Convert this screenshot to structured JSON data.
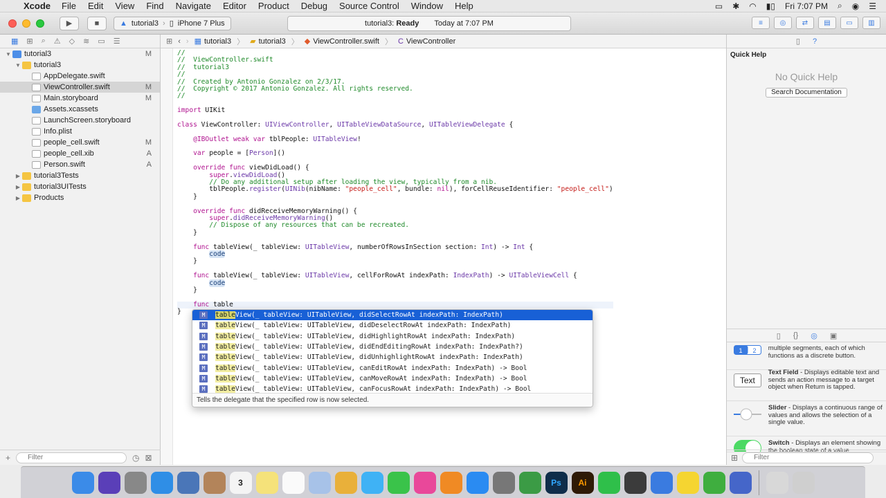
{
  "menubar": {
    "app": "Xcode",
    "menus": [
      "File",
      "Edit",
      "View",
      "Find",
      "Navigate",
      "Editor",
      "Product",
      "Debug",
      "Source Control",
      "Window",
      "Help"
    ],
    "clock": "Fri 7:07 PM"
  },
  "toolbar": {
    "scheme_target": "tutorial3",
    "scheme_device": "iPhone 7 Plus",
    "status_project": "tutorial3:",
    "status_state": "Ready",
    "status_time": "Today at 7:07 PM"
  },
  "navigator": {
    "items": [
      {
        "label": "tutorial3",
        "status": "M",
        "icon": "project-icon",
        "indent": 0,
        "tri": "▼"
      },
      {
        "label": "tutorial3",
        "status": "",
        "icon": "folder-icon",
        "indent": 1,
        "tri": "▼"
      },
      {
        "label": "AppDelegate.swift",
        "status": "",
        "icon": "swift-file-icon",
        "indent": 2,
        "tri": ""
      },
      {
        "label": "ViewController.swift",
        "status": "M",
        "icon": "swift-file-icon",
        "indent": 2,
        "tri": "",
        "selected": true
      },
      {
        "label": "Main.storyboard",
        "status": "M",
        "icon": "storyboard-icon",
        "indent": 2,
        "tri": ""
      },
      {
        "label": "Assets.xcassets",
        "status": "",
        "icon": "assets-icon",
        "indent": 2,
        "tri": ""
      },
      {
        "label": "LaunchScreen.storyboard",
        "status": "",
        "icon": "storyboard-icon",
        "indent": 2,
        "tri": ""
      },
      {
        "label": "Info.plist",
        "status": "",
        "icon": "plist-icon",
        "indent": 2,
        "tri": ""
      },
      {
        "label": "people_cell.swift",
        "status": "M",
        "icon": "swift-file-icon",
        "indent": 2,
        "tri": ""
      },
      {
        "label": "people_cell.xib",
        "status": "A",
        "icon": "xib-icon",
        "indent": 2,
        "tri": ""
      },
      {
        "label": "Person.swift",
        "status": "A",
        "icon": "swift-file-icon",
        "indent": 2,
        "tri": ""
      },
      {
        "label": "tutorial3Tests",
        "status": "",
        "icon": "folder-icon",
        "indent": 1,
        "tri": "▶"
      },
      {
        "label": "tutorial3UITests",
        "status": "",
        "icon": "folder-icon",
        "indent": 1,
        "tri": "▶"
      },
      {
        "label": "Products",
        "status": "",
        "icon": "folder-icon",
        "indent": 1,
        "tri": "▶"
      }
    ],
    "filter_placeholder": "Filter"
  },
  "jumpbar": {
    "crumbs": [
      "tutorial3",
      "tutorial3",
      "ViewController.swift",
      "ViewController"
    ]
  },
  "code_lines": [
    [
      {
        "t": "//",
        "c": "com"
      }
    ],
    [
      {
        "t": "//  ViewController.swift",
        "c": "com"
      }
    ],
    [
      {
        "t": "//  tutorial3",
        "c": "com"
      }
    ],
    [
      {
        "t": "//",
        "c": "com"
      }
    ],
    [
      {
        "t": "//  Created by Antonio Gonzalez on 2/3/17.",
        "c": "com"
      }
    ],
    [
      {
        "t": "//  Copyright © 2017 Antonio Gonzalez. All rights reserved.",
        "c": "com"
      }
    ],
    [
      {
        "t": "//",
        "c": "com"
      }
    ],
    [],
    [
      {
        "t": "import",
        "c": "kw"
      },
      {
        "t": " UIKit"
      }
    ],
    [],
    [
      {
        "t": "class",
        "c": "kw"
      },
      {
        "t": " ViewController: "
      },
      {
        "t": "UIViewController",
        "c": "type"
      },
      {
        "t": ", "
      },
      {
        "t": "UITableViewDataSource",
        "c": "type"
      },
      {
        "t": ", "
      },
      {
        "t": "UITableViewDelegate",
        "c": "type"
      },
      {
        "t": " {"
      }
    ],
    [],
    [
      {
        "t": "    "
      },
      {
        "t": "@IBOutlet",
        "c": "kw"
      },
      {
        "t": " "
      },
      {
        "t": "weak",
        "c": "kw"
      },
      {
        "t": " "
      },
      {
        "t": "var",
        "c": "kw"
      },
      {
        "t": " tblPeople: "
      },
      {
        "t": "UITableView",
        "c": "type"
      },
      {
        "t": "!"
      }
    ],
    [],
    [
      {
        "t": "    "
      },
      {
        "t": "var",
        "c": "kw"
      },
      {
        "t": " people = ["
      },
      {
        "t": "Person",
        "c": "type"
      },
      {
        "t": "]()"
      }
    ],
    [],
    [
      {
        "t": "    "
      },
      {
        "t": "override",
        "c": "kw"
      },
      {
        "t": " "
      },
      {
        "t": "func",
        "c": "kw"
      },
      {
        "t": " viewDidLoad() {"
      }
    ],
    [
      {
        "t": "        "
      },
      {
        "t": "super",
        "c": "kw"
      },
      {
        "t": "."
      },
      {
        "t": "viewDidLoad",
        "c": "type"
      },
      {
        "t": "()"
      }
    ],
    [
      {
        "t": "        "
      },
      {
        "t": "// Do any additional setup after loading the view, typically from a nib.",
        "c": "com"
      }
    ],
    [
      {
        "t": "        tblPeople."
      },
      {
        "t": "register",
        "c": "type"
      },
      {
        "t": "("
      },
      {
        "t": "UINib",
        "c": "type"
      },
      {
        "t": "(nibName: "
      },
      {
        "t": "\"people_cell\"",
        "c": "str"
      },
      {
        "t": ", bundle: "
      },
      {
        "t": "nil",
        "c": "kw"
      },
      {
        "t": "), forCellReuseIdentifier: "
      },
      {
        "t": "\"people_cell\"",
        "c": "str"
      },
      {
        "t": ")"
      }
    ],
    [
      {
        "t": "    }"
      }
    ],
    [],
    [
      {
        "t": "    "
      },
      {
        "t": "override",
        "c": "kw"
      },
      {
        "t": " "
      },
      {
        "t": "func",
        "c": "kw"
      },
      {
        "t": " didReceiveMemoryWarning() {"
      }
    ],
    [
      {
        "t": "        "
      },
      {
        "t": "super",
        "c": "kw"
      },
      {
        "t": "."
      },
      {
        "t": "didReceiveMemoryWarning",
        "c": "type"
      },
      {
        "t": "()"
      }
    ],
    [
      {
        "t": "        "
      },
      {
        "t": "// Dispose of any resources that can be recreated.",
        "c": "com"
      }
    ],
    [
      {
        "t": "    }"
      }
    ],
    [],
    [
      {
        "t": "    "
      },
      {
        "t": "func",
        "c": "kw"
      },
      {
        "t": " tableView(_ tableView: "
      },
      {
        "t": "UITableView",
        "c": "type"
      },
      {
        "t": ", numberOfRowsInSection section: "
      },
      {
        "t": "Int",
        "c": "type"
      },
      {
        "t": ") -> "
      },
      {
        "t": "Int",
        "c": "type"
      },
      {
        "t": " {"
      }
    ],
    [
      {
        "t": "        "
      },
      {
        "t": "code",
        "c": "ph"
      }
    ],
    [
      {
        "t": "    }"
      }
    ],
    [],
    [
      {
        "t": "    "
      },
      {
        "t": "func",
        "c": "kw"
      },
      {
        "t": " tableView(_ tableView: "
      },
      {
        "t": "UITableView",
        "c": "type"
      },
      {
        "t": ", cellForRowAt indexPath: "
      },
      {
        "t": "IndexPath",
        "c": "type"
      },
      {
        "t": ") -> "
      },
      {
        "t": "UITableViewCell",
        "c": "type"
      },
      {
        "t": " {"
      }
    ],
    [
      {
        "t": "        "
      },
      {
        "t": "code",
        "c": "ph"
      }
    ],
    [
      {
        "t": "    }"
      }
    ],
    [],
    [
      {
        "t": "    "
      },
      {
        "t": "func",
        "c": "kw"
      },
      {
        "t": " table"
      }
    ],
    [
      {
        "t": "}"
      }
    ]
  ],
  "autocomplete": {
    "typed": "table",
    "items": [
      {
        "rest": "View(_ tableView: UITableView, didSelectRowAt indexPath: IndexPath)",
        "selected": true
      },
      {
        "rest": "View(_ tableView: UITableView, didDeselectRowAt indexPath: IndexPath)"
      },
      {
        "rest": "View(_ tableView: UITableView, didHighlightRowAt indexPath: IndexPath)"
      },
      {
        "rest": "View(_ tableView: UITableView, didEndEditingRowAt indexPath: IndexPath?)"
      },
      {
        "rest": "View(_ tableView: UITableView, didUnhighlightRowAt indexPath: IndexPath)"
      },
      {
        "rest": "View(_ tableView: UITableView, canEditRowAt indexPath: IndexPath) -> Bool"
      },
      {
        "rest": "View(_ tableView: UITableView, canMoveRowAt indexPath: IndexPath) -> Bool"
      },
      {
        "rest": "View(_ tableView: UITableView, canFocusRowAt indexPath: IndexPath) -> Bool"
      }
    ],
    "badge": "M",
    "description": "Tells the delegate that the specified row is now selected."
  },
  "quick_help": {
    "title": "Quick Help",
    "empty": "No Quick Help",
    "search_button": "Search Documentation"
  },
  "library": {
    "items": [
      {
        "name": "",
        "desc": "multiple segments, each of which functions as a discrete button.",
        "thumb": "segmented-control-icon"
      },
      {
        "name": "Text Field",
        "desc": " - Displays editable text and sends an action message to a target object when Return is tapped.",
        "thumb": "text-field-icon",
        "thumb_text": "Text"
      },
      {
        "name": "Slider",
        "desc": " - Displays a continuous range of values and allows the selection of a single value.",
        "thumb": "slider-icon"
      },
      {
        "name": "Switch",
        "desc": " - Displays an element showing the boolean state of a value.",
        "thumb": "switch-icon"
      }
    ],
    "filter_placeholder": "Filter"
  },
  "dock": [
    {
      "name": "finder-icon",
      "color": "#3b8be8"
    },
    {
      "name": "siri-icon",
      "color": "#5a3fb8"
    },
    {
      "name": "launchpad-icon",
      "color": "#888"
    },
    {
      "name": "safari-icon",
      "color": "#2f8ee6"
    },
    {
      "name": "mail-icon",
      "color": "#4a76b8"
    },
    {
      "name": "contacts-icon",
      "color": "#b3845a"
    },
    {
      "name": "calendar-icon",
      "color": "#f4f4f4",
      "text": "3",
      "text_color": "#222"
    },
    {
      "name": "notes-icon",
      "color": "#f5e27a"
    },
    {
      "name": "reminders-icon",
      "color": "#fafafa"
    },
    {
      "name": "preview-icon",
      "color": "#a7c2e8"
    },
    {
      "name": "photos-icon",
      "color": "#e9b03a"
    },
    {
      "name": "messages-icon",
      "color": "#3fb2f5"
    },
    {
      "name": "facetime-icon",
      "color": "#3ac34a"
    },
    {
      "name": "itunes-icon",
      "color": "#e9489a"
    },
    {
      "name": "ibooks-icon",
      "color": "#f08a24"
    },
    {
      "name": "app-store-icon",
      "color": "#2a8bf2"
    },
    {
      "name": "system-preferences-icon",
      "color": "#777"
    },
    {
      "name": "numbers-icon",
      "color": "#3b9b45"
    },
    {
      "name": "photoshop-icon",
      "color": "#0f2d4a",
      "text": "Ps",
      "text_color": "#31a8ff"
    },
    {
      "name": "illustrator-icon",
      "color": "#2e1a06",
      "text": "Ai",
      "text_color": "#ff9a00"
    },
    {
      "name": "whatsapp-icon",
      "color": "#2fbf4a"
    },
    {
      "name": "screen-app-icon",
      "color": "#3b3b3b"
    },
    {
      "name": "xcode-icon",
      "color": "#3a7be0"
    },
    {
      "name": "lemon-icon",
      "color": "#f5d531"
    },
    {
      "name": "utorrent-icon",
      "color": "#3fae3f"
    },
    {
      "name": "screen-recorder-icon",
      "color": "#4566c9"
    },
    {
      "name": "downloads-icon",
      "color": "#d8d8d8"
    },
    {
      "name": "trash-icon",
      "color": "#cfcfcf"
    }
  ]
}
